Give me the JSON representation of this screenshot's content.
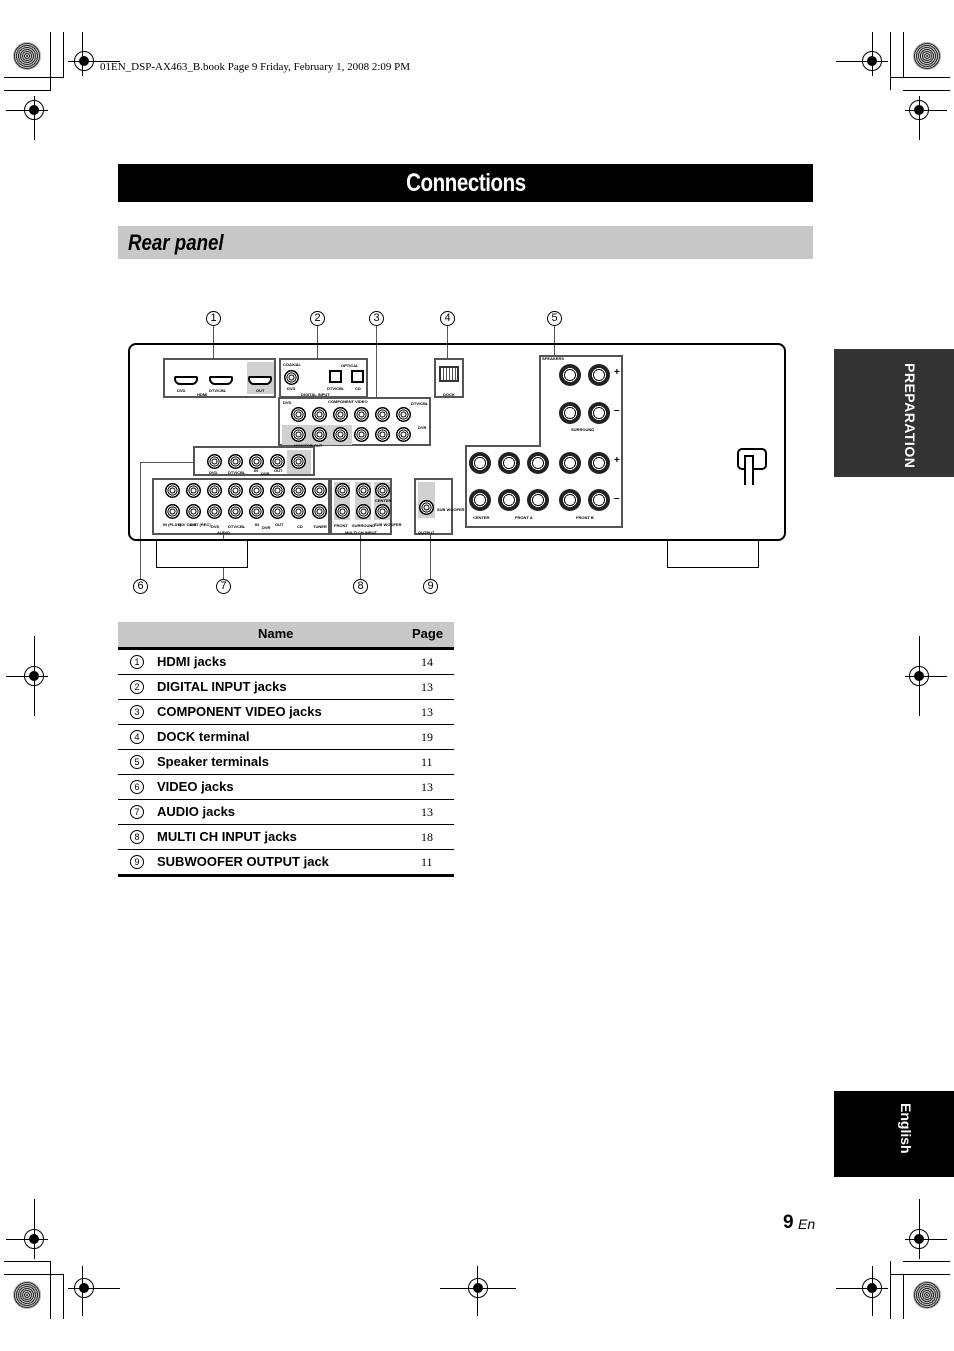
{
  "print_header": "01EN_DSP-AX463_B.book  Page 9  Friday, February 1, 2008  2:09 PM",
  "title": "Connections",
  "section": "Rear panel",
  "side_tab": "PREPARATION",
  "language_tab": "English",
  "page": {
    "number": "9",
    "suffix": "En"
  },
  "diagram": {
    "callouts": [
      "1",
      "2",
      "3",
      "4",
      "5",
      "6",
      "7",
      "8",
      "9"
    ],
    "labels": {
      "hdmi": "HDMI",
      "hdmi_dvd": "DVD",
      "hdmi_dtv": "DTV/CBL",
      "hdmi_out": "OUT",
      "coaxial": "COAXIAL",
      "optical": "OPTICAL",
      "digital_input": "DIGITAL INPUT",
      "dig_dvd": "DVD",
      "dig_dtv": "DTV/CBL",
      "dig_cd": "CD",
      "component_video": "COMPONENT VIDEO",
      "comp_dvd": "DVD",
      "comp_dtv": "DTV/CBL",
      "comp_dvr": "DVR",
      "monitor_out": "MONITOR OUT",
      "dock": "DOCK",
      "speakers": "SPEAKERS",
      "surround": "SURROUND",
      "center": "CENTER",
      "front_a": "FRONT A",
      "front_b": "FRONT B",
      "plus": "+",
      "minus": "–",
      "video": "VIDEO",
      "vid_dvd": "DVD",
      "vid_dtv": "DTV/CBL",
      "vid_in": "IN",
      "vid_dvr": "DVR",
      "vid_out": "OUT",
      "vid_monitor_out": "MONITOR OUT",
      "audio": "AUDIO",
      "aud_in_play": "IN (PLAY)",
      "aud_md": "MD/ CD-R",
      "aud_out_rec": "OUT (REC)",
      "aud_dvd": "DVD",
      "aud_dtv": "DTV/CBL",
      "aud_in": "IN",
      "aud_dvr": "DVR",
      "aud_out": "OUT",
      "aud_cd": "CD",
      "aud_tuner": "TUNER",
      "multi_ch_input": "MULTI CH INPUT",
      "mc_front": "FRONT",
      "mc_surround": "SURROUND",
      "mc_center": "CENTER",
      "mc_sub": "SUB WOOFER",
      "output": "OUTPUT",
      "out_sub": "SUB WOOFER"
    }
  },
  "table": {
    "headers": {
      "name": "Name",
      "page": "Page"
    },
    "rows": [
      {
        "num": "1",
        "name": "HDMI jacks",
        "page": "14"
      },
      {
        "num": "2",
        "name": "DIGITAL INPUT jacks",
        "page": "13"
      },
      {
        "num": "3",
        "name": "COMPONENT VIDEO jacks",
        "page": "13"
      },
      {
        "num": "4",
        "name": "DOCK terminal",
        "page": "19"
      },
      {
        "num": "5",
        "name": "Speaker terminals",
        "page": "11"
      },
      {
        "num": "6",
        "name": "VIDEO jacks",
        "page": "13"
      },
      {
        "num": "7",
        "name": "AUDIO jacks",
        "page": "13"
      },
      {
        "num": "8",
        "name": "MULTI CH INPUT jacks",
        "page": "18"
      },
      {
        "num": "9",
        "name": "SUBWOOFER OUTPUT jack",
        "page": "11"
      }
    ]
  }
}
